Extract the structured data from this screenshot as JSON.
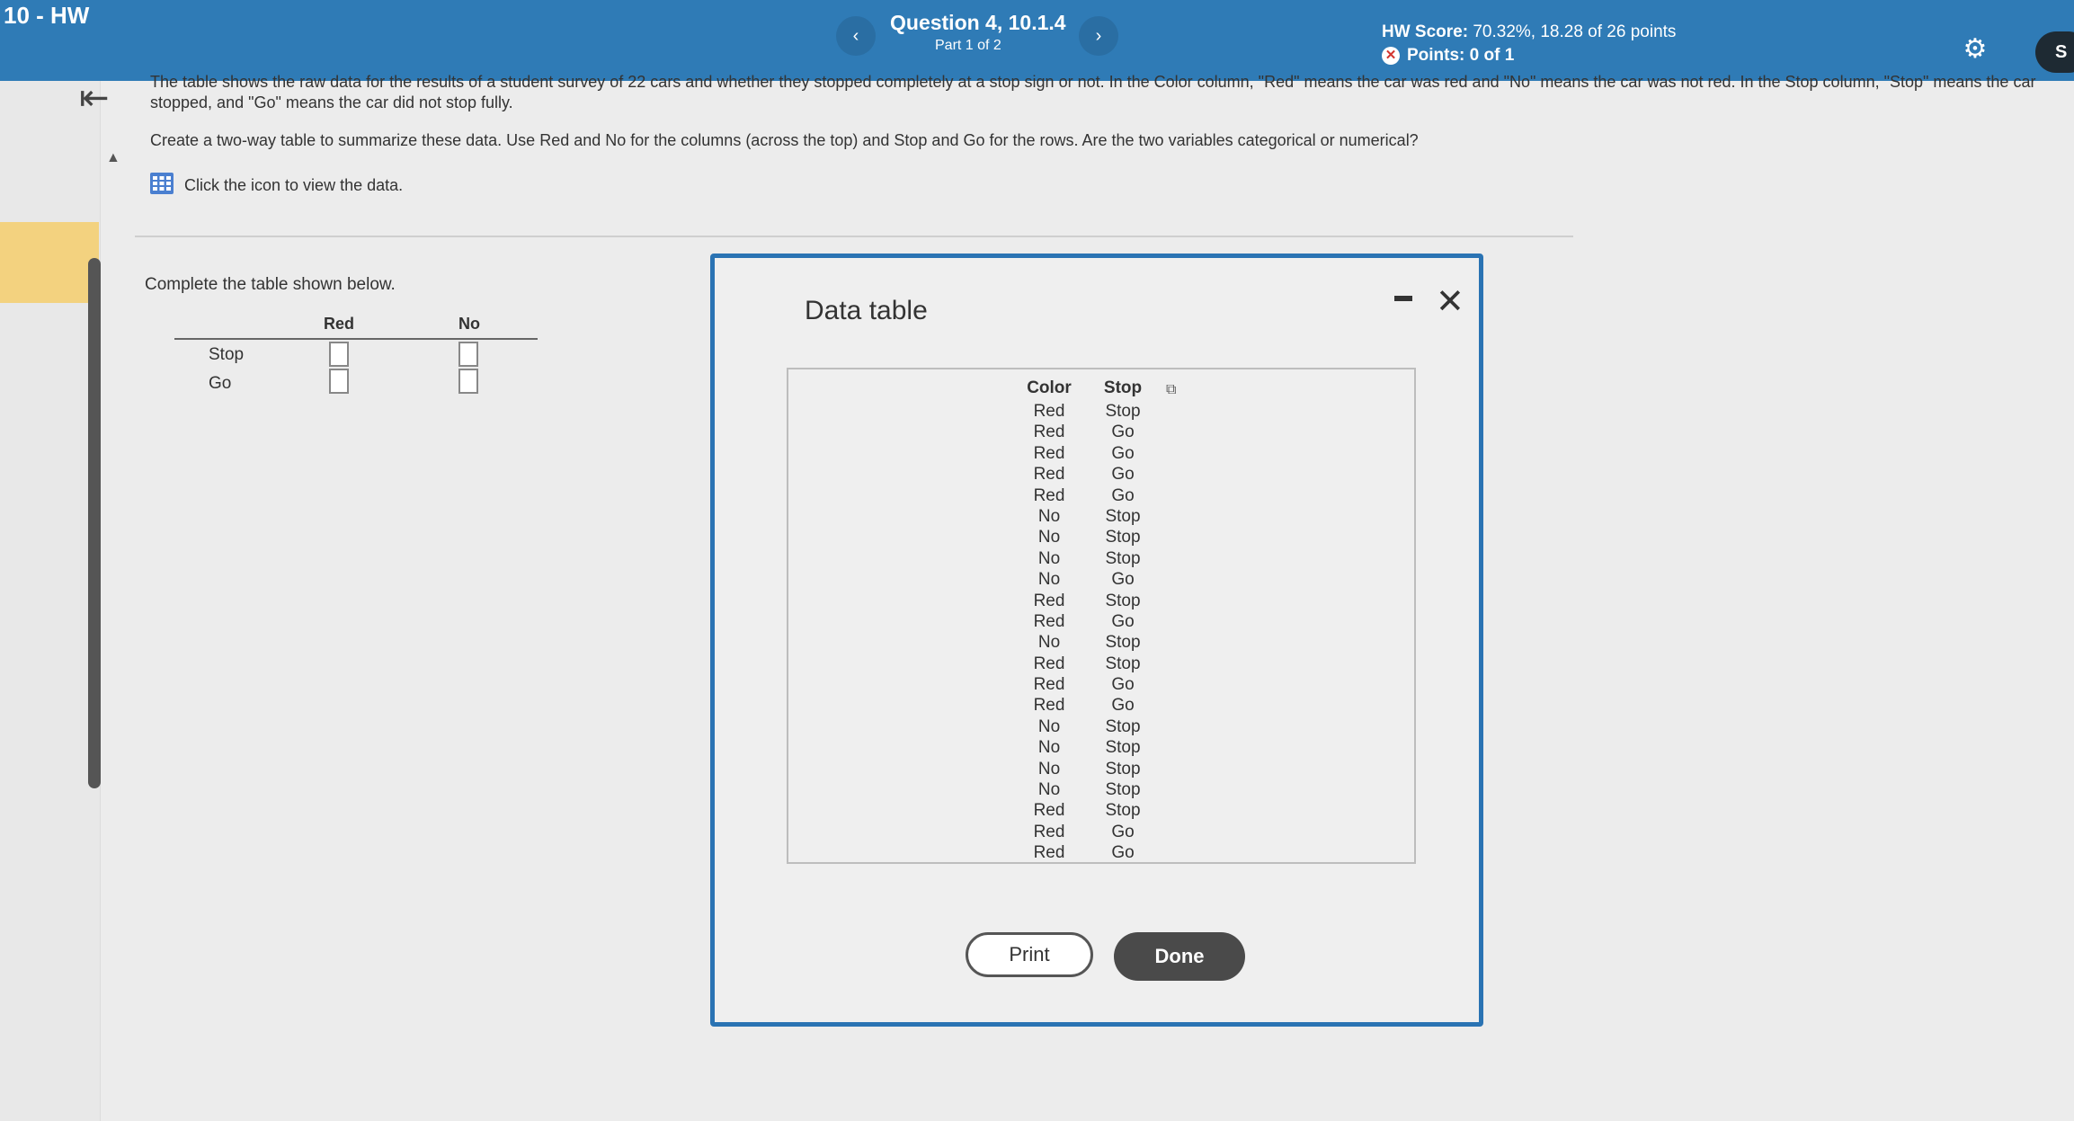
{
  "header": {
    "assignment_title": "10 - HW",
    "question_title": "Question 4, 10.1.4",
    "question_part": "Part 1 of 2",
    "hw_score_label": "HW Score:",
    "hw_score_value": "70.32%, 18.28 of 26 points",
    "points_label": "Points: 0 of 1",
    "save_label": "S",
    "prev_symbol": "‹",
    "next_symbol": "›",
    "colors": {
      "bar": "#2f7bb6",
      "incorrect": "#d2352f"
    }
  },
  "question": {
    "paragraph1": "The table shows the raw data for the results of a student survey of 22 cars and whether they stopped completely at a stop sign or not. In the Color column, \"Red\" means the car was red and \"No\" means the car was not red. In the Stop column, \"Stop\" means the car stopped, and \"Go\" means the car did not stop fully.",
    "paragraph2": "Create a two-way table to summarize these data. Use Red and No for the columns (across the top) and Stop and Go for the rows. Are the two variables categorical or numerical?",
    "data_link": "Click the icon to view the data."
  },
  "answer": {
    "instruction": "Complete the table shown below.",
    "columns": [
      "Red",
      "No"
    ],
    "rows": [
      "Stop",
      "Go"
    ]
  },
  "modal": {
    "title": "Data table",
    "headers": [
      "Color",
      "Stop"
    ],
    "rows": [
      [
        "Red",
        "Stop"
      ],
      [
        "Red",
        "Go"
      ],
      [
        "Red",
        "Go"
      ],
      [
        "Red",
        "Go"
      ],
      [
        "Red",
        "Go"
      ],
      [
        "No",
        "Stop"
      ],
      [
        "No",
        "Stop"
      ],
      [
        "No",
        "Stop"
      ],
      [
        "No",
        "Go"
      ],
      [
        "Red",
        "Stop"
      ],
      [
        "Red",
        "Go"
      ],
      [
        "No",
        "Stop"
      ],
      [
        "Red",
        "Stop"
      ],
      [
        "Red",
        "Go"
      ],
      [
        "Red",
        "Go"
      ],
      [
        "No",
        "Stop"
      ],
      [
        "No",
        "Stop"
      ],
      [
        "No",
        "Stop"
      ],
      [
        "No",
        "Stop"
      ],
      [
        "Red",
        "Stop"
      ],
      [
        "Red",
        "Go"
      ],
      [
        "Red",
        "Go"
      ]
    ],
    "print_label": "Print",
    "done_label": "Done",
    "close_symbol": "✕"
  },
  "icons": {
    "back": "back-arrow-icon",
    "settings": "gear-icon",
    "data": "grid-table-icon",
    "copy": "copy-icon",
    "incorrect": "x-circle-icon"
  }
}
